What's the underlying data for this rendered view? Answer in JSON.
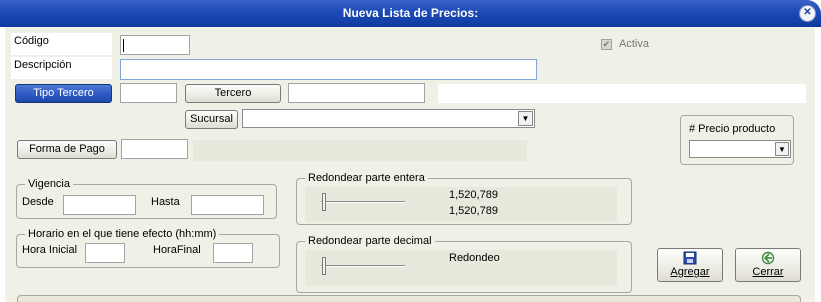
{
  "window": {
    "title": "Nueva Lista de Precios:"
  },
  "fields": {
    "codigo_label": "Código",
    "descripcion_label": "Descripción",
    "activa_label": "Activa",
    "precio_producto_label": "# Precio producto"
  },
  "buttons": {
    "tipo_tercero": "Tipo Tercero",
    "tercero": "Tercero",
    "sucursal": "Sucursal",
    "forma_pago": "Forma de Pago",
    "agregar": "Agregar",
    "cerrar": "Cerrar"
  },
  "vigencia": {
    "legend": "Vigencia",
    "desde": "Desde",
    "hasta": "Hasta"
  },
  "horario": {
    "legend": "Horario en el que tiene efecto   (hh:mm)",
    "hora_inicial": "Hora Inicial",
    "hora_final": "HoraFinal"
  },
  "redondear_entera": {
    "legend": "Redondear parte entera",
    "value1": "1,520,789",
    "value2": "1,520,789"
  },
  "redondear_decimal": {
    "legend": "Redondear parte decimal",
    "value": "Redondeo"
  },
  "icons": {
    "close": "close-icon",
    "save": "save-icon",
    "exit": "exit-icon",
    "checkbox": "checkbox-checked-icon",
    "dropdown": "chevron-down-icon"
  },
  "colors": {
    "titlebar": "#1e4cb8",
    "accent_button": "#2a58c0",
    "background": "#f0f0e6"
  }
}
